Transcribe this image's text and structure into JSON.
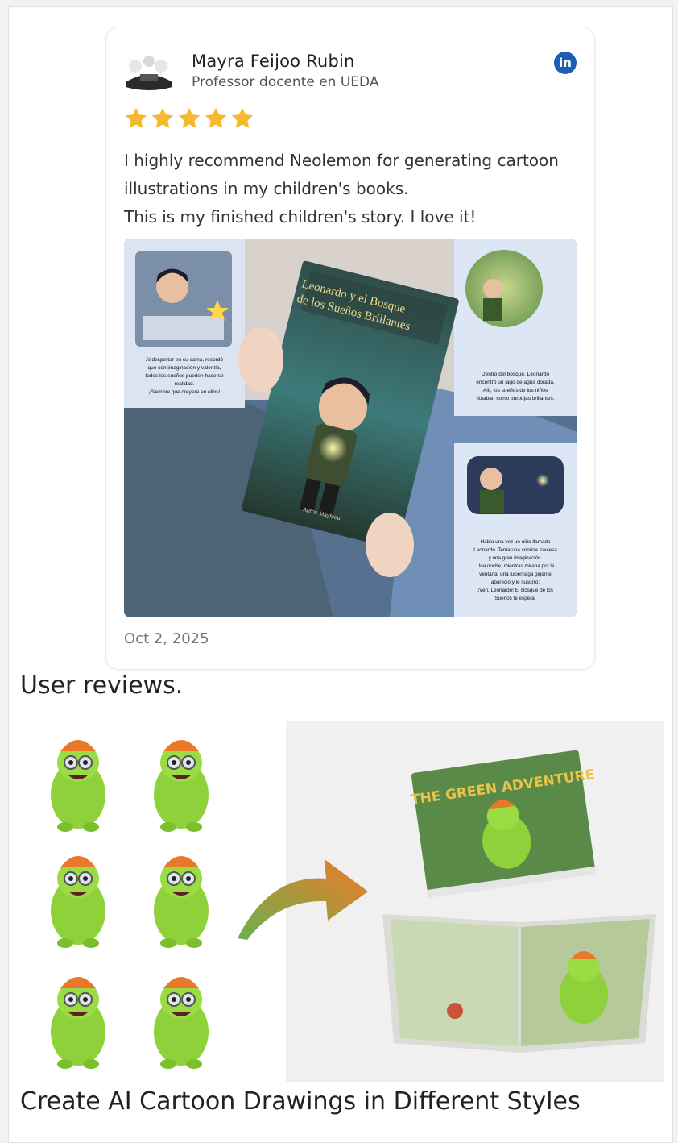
{
  "review": {
    "author_name": "Mayra Feijoo Rubin",
    "author_role": "Professor docente en UEDA",
    "rating": 5,
    "text_lines": [
      "I highly recommend Neolemon for generating cartoon",
      "illustrations in my children's books.",
      "This is my finished children's story. I love it!"
    ],
    "date": "Oct 2, 2025",
    "book_title": "Leonardo y el Bosque de los Sueños Brillantes",
    "book_author": "Autor: Mayfeiru",
    "panel_texts": {
      "left": "Al despertar en su cama, recordó que con imaginación y valentía, todos los sueños pueden hacerse realidad. ¡Siempre que creyera en ellos!",
      "right_top": "Dentro del bosque, Leonardo encontró un lago de agua dorada. Allí, los sueños de los niños flotaban como burbujas brillantes.",
      "right_bottom": "Había una vez un niño llamado Leonardo. Tenía una sonrisa traviesa y una gran imaginación. Una noche, mientras miraba por la ventana, una luciérnaga gigante apareció y le susurró: ¡Ven, Leonardo! El Bosque de los Sueños te espera."
    }
  },
  "captions": {
    "user_reviews": "User reviews.",
    "cartoon_styles": "Create AI Cartoon Drawings in Different Styles"
  },
  "cartoon_image": {
    "book_cover_title": "THE GREEN ADVENTURE"
  },
  "colors": {
    "star": "#f5b82e",
    "linkedin": "#1c5fb2",
    "monster_green": "#8fd13a",
    "hat_orange": "#e8782a"
  }
}
